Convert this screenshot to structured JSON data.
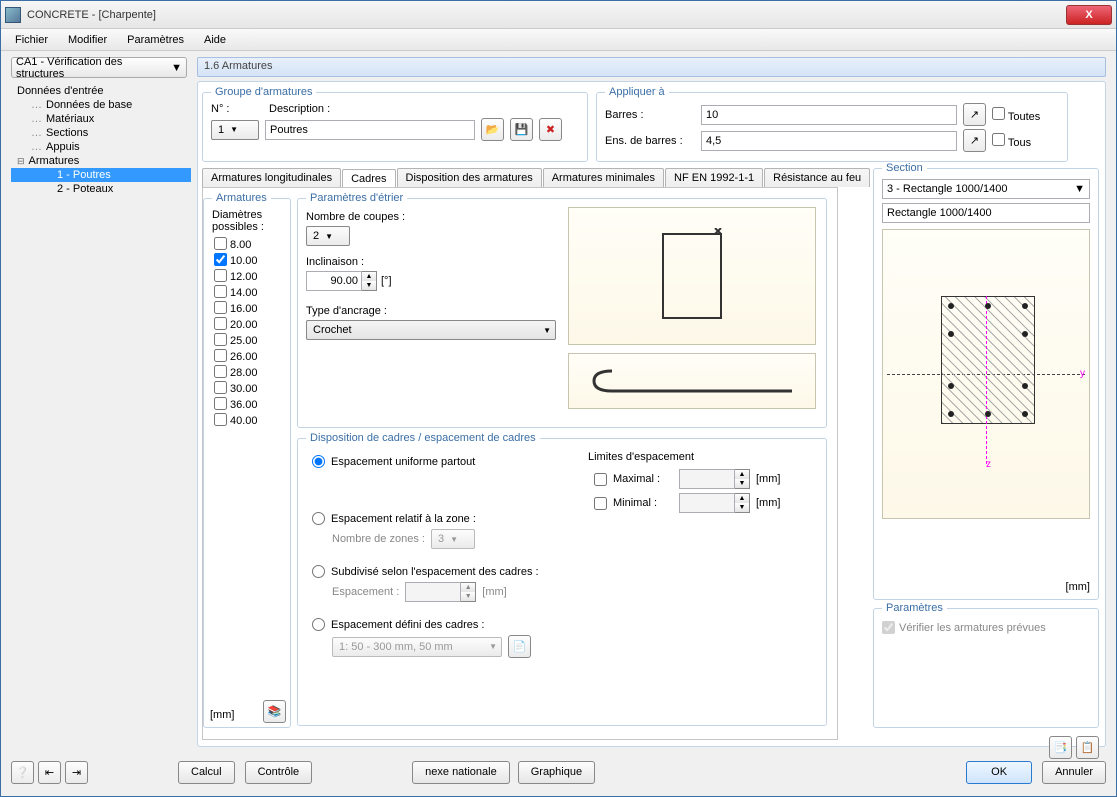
{
  "window": {
    "title": "CONCRETE - [Charpente]",
    "close": "X"
  },
  "menu": [
    "Fichier",
    "Modifier",
    "Paramètres",
    "Aide"
  ],
  "modDrop": "CA1 - Vérification des structures",
  "tree": {
    "root": "Données d'entrée",
    "items": [
      "Données de base",
      "Matériaux",
      "Sections",
      "Appuis"
    ],
    "arm": "Armatures",
    "armChildren": [
      "1 - Poutres",
      "2 - Poteaux"
    ]
  },
  "page": {
    "title": "1.6 Armatures"
  },
  "group1": {
    "title": "Groupe d'armatures",
    "numLabel": "N° :",
    "descLabel": "Description :",
    "num": "1",
    "desc": "Poutres"
  },
  "group2": {
    "title": "Appliquer à",
    "barresLbl": "Barres :",
    "barres": "10",
    "ensLbl": "Ens. de barres :",
    "ens": "4,5",
    "toutes": "Toutes",
    "tous": "Tous"
  },
  "tabs": [
    "Armatures longitudinales",
    "Cadres",
    "Disposition des armatures",
    "Armatures minimales",
    "NF EN 1992-1-1",
    "Résistance au feu"
  ],
  "arm": {
    "title": "Armatures",
    "diamLbl": "Diamètres possibles :",
    "unit": "[mm]",
    "diams": [
      "8.00",
      "10.00",
      "12.00",
      "14.00",
      "16.00",
      "20.00",
      "25.00",
      "26.00",
      "28.00",
      "30.00",
      "36.00",
      "40.00"
    ],
    "checked": "10.00"
  },
  "param": {
    "title": "Paramètres d'étrier",
    "nbLbl": "Nombre de coupes :",
    "nb": "2",
    "incLbl": "Inclinaison :",
    "inc": "90.00",
    "incUnit": "[°]",
    "ancLbl": "Type d'ancrage :",
    "anc": "Crochet"
  },
  "disp": {
    "title": "Disposition de cadres / espacement de cadres",
    "r1": "Espacement uniforme partout",
    "limLbl": "Limites d'espacement",
    "maxLbl": "Maximal :",
    "minLbl": "Minimal :",
    "mm": "[mm]",
    "r2": "Espacement relatif à la zone :",
    "r2sub": "Nombre de zones :",
    "r2val": "3",
    "r3": "Subdivisé selon l'espacement des cadres :",
    "r3sub": "Espacement :",
    "r4": "Espacement défini des cadres :",
    "r4val": "1: 50 - 300 mm, 50 mm"
  },
  "section": {
    "title": "Section",
    "sel": "3 - Rectangle 1000/1400",
    "name": "Rectangle 1000/1400",
    "unit": "[mm]",
    "axes": {
      "y": "y",
      "z": "z"
    }
  },
  "pars": {
    "title": "Paramètres",
    "ver": "Vérifier les armatures prévues"
  },
  "footer": {
    "calcul": "Calcul",
    "controle": "Contrôle",
    "annexe": "nexe nationale",
    "graph": "Graphique",
    "ok": "OK",
    "cancel": "Annuler"
  }
}
